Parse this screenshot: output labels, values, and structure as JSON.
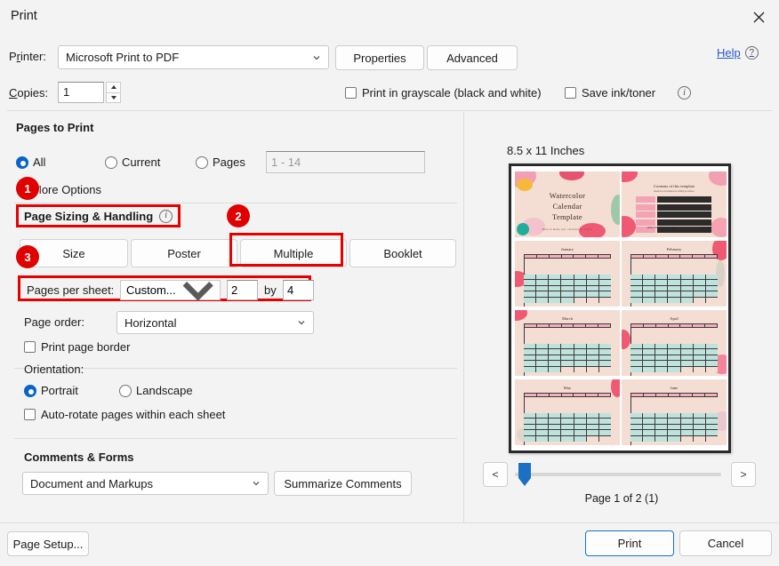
{
  "window": {
    "title": "Print",
    "close_icon": "close-icon"
  },
  "printer": {
    "label": "Printer:",
    "value": "Microsoft Print to PDF",
    "properties_label": "Properties",
    "advanced_label": "Advanced",
    "help_label": "Help",
    "help_icon": "question-mark-icon",
    "copies_label": "Copies:",
    "copies_value": "1",
    "grayscale_label": "Print in grayscale (black and white)",
    "grayscale_checked": false,
    "save_ink_label": "Save ink/toner",
    "save_ink_checked": false,
    "info_icon": "info-icon"
  },
  "pages_to_print": {
    "title": "Pages to Print",
    "options": [
      {
        "label": "All",
        "selected": true
      },
      {
        "label": "Current",
        "selected": false
      },
      {
        "label": "Pages",
        "selected": false
      }
    ],
    "range_placeholder": "1 - 14",
    "more_options_label": "More Options"
  },
  "page_sizing": {
    "title": "Page Sizing & Handling",
    "info_icon": "info-icon",
    "modes": [
      {
        "label": "Size",
        "active": false
      },
      {
        "label": "Poster",
        "active": false
      },
      {
        "label": "Multiple",
        "active": true
      },
      {
        "label": "Booklet",
        "active": false
      }
    ],
    "pages_per_sheet_label": "Pages per sheet:",
    "pages_per_sheet_value": "Custom...",
    "rows_value": "2",
    "by_label": "by",
    "cols_value": "4",
    "page_order_label": "Page order:",
    "page_order_value": "Horizontal",
    "print_page_border_label": "Print page border",
    "print_page_border_checked": false
  },
  "orientation": {
    "title": "Orientation:",
    "options": [
      {
        "label": "Portrait",
        "selected": true
      },
      {
        "label": "Landscape",
        "selected": false
      }
    ],
    "auto_rotate_label": "Auto-rotate pages within each sheet",
    "auto_rotate_checked": false
  },
  "comments_forms": {
    "title": "Comments & Forms",
    "value": "Document and Markups",
    "summarize_label": "Summarize Comments"
  },
  "preview": {
    "paper_size": "8.5 x 11 Inches",
    "page_indicator": "Page 1 of 2 (1)",
    "prev_label": "<",
    "next_label": ">",
    "document": {
      "title_lines": [
        "Watercolor",
        "Calendar",
        "Template"
      ],
      "title_subtitle": "Here is made jan. calendar in Valpar",
      "toc_heading": "Contents of this template",
      "toc_subtitle": "Read the text shapes for editing its content",
      "toc_footer_left": "slides SLIDE service",
      "toc_footer_right": "slides SLIDESGO.com",
      "months": [
        "January",
        "February",
        "March",
        "April",
        "May",
        "June"
      ]
    }
  },
  "footer": {
    "page_setup_label": "Page Setup...",
    "print_label": "Print",
    "cancel_label": "Cancel"
  },
  "annotations": {
    "badges": [
      "1",
      "2",
      "3"
    ],
    "highlight_color": "#e60000"
  }
}
